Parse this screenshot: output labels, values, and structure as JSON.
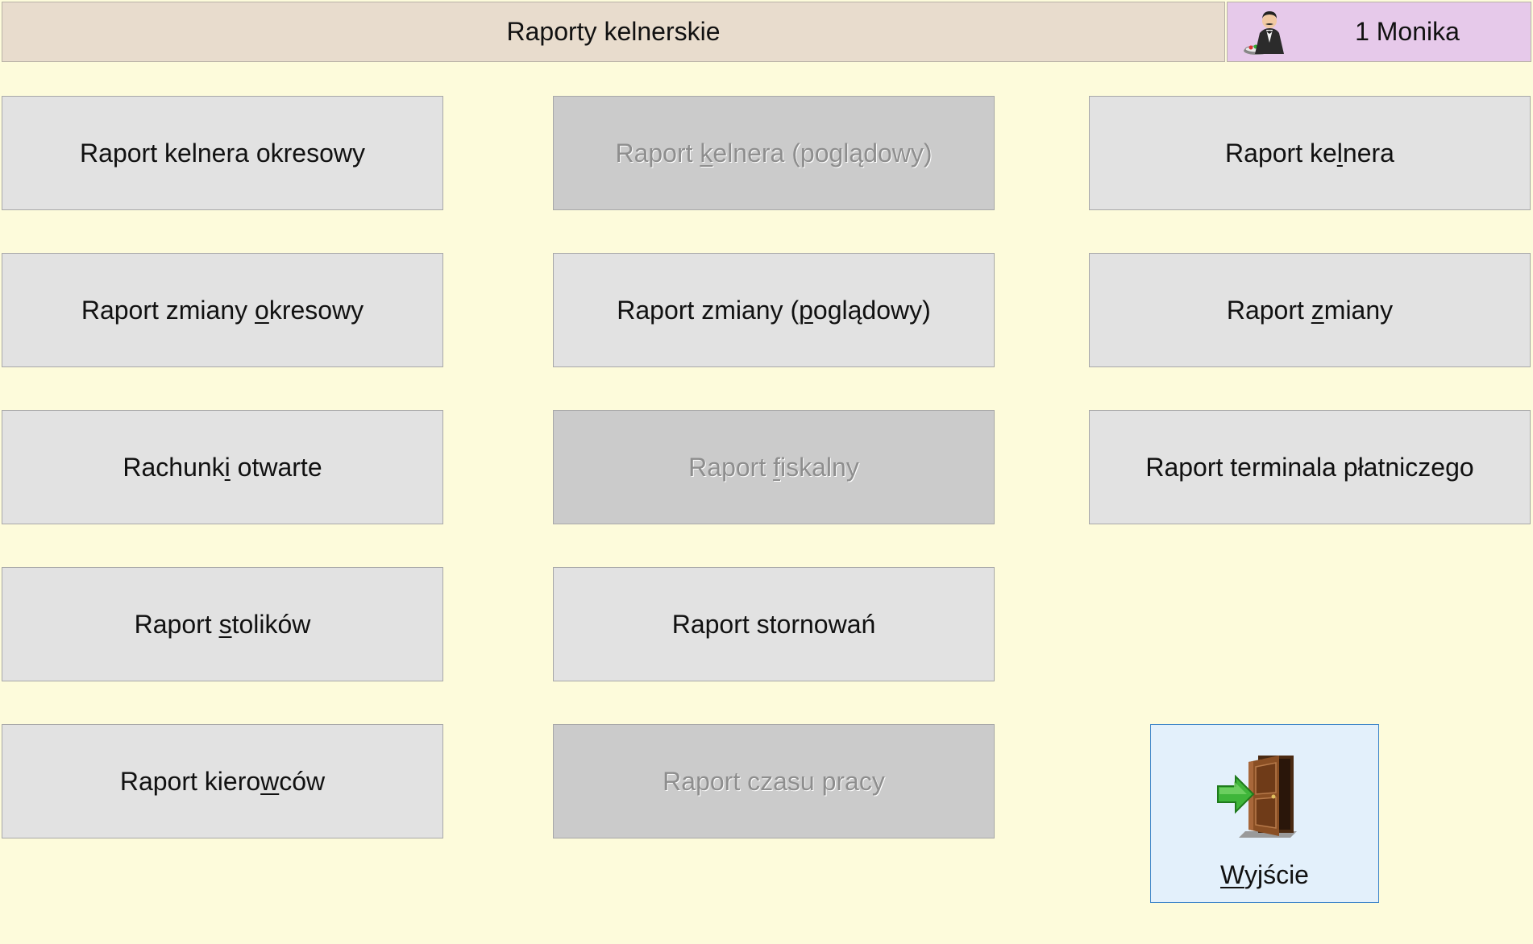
{
  "header": {
    "title": "Raporty kelnerskie",
    "user": "1 Monika"
  },
  "buttons": {
    "raport_kelnera_okresowy": {
      "pre": "Raport kelnera okresowy",
      "key": "",
      "post": "",
      "enabled": true
    },
    "raport_kelnera_pogladowy": {
      "pre": "Raport ",
      "key": "k",
      "post": "elnera (poglądowy)",
      "enabled": false
    },
    "raport_kelnera": {
      "pre": "Raport ke",
      "key": "l",
      "post": "nera",
      "enabled": true
    },
    "raport_zmiany_okresowy": {
      "pre": "Raport zmiany ",
      "key": "o",
      "post": "kresowy",
      "enabled": true
    },
    "raport_zmiany_pogladowy": {
      "pre": "Raport zmiany (",
      "key": "p",
      "post": "oglądowy)",
      "enabled": true
    },
    "raport_zmiany": {
      "pre": "Raport ",
      "key": "z",
      "post": "miany",
      "enabled": true
    },
    "rachunki_otwarte": {
      "pre": "Rachunk",
      "key": "i",
      "post": " otwarte",
      "enabled": true
    },
    "raport_fiskalny": {
      "pre": "Raport ",
      "key": "f",
      "post": "iskalny",
      "enabled": false
    },
    "raport_terminala": {
      "pre": "Raport terminala płatniczego",
      "key": "",
      "post": "",
      "enabled": true
    },
    "raport_stolikow": {
      "pre": "Raport ",
      "key": "s",
      "post": "tolików",
      "enabled": true
    },
    "raport_stornowan": {
      "pre": "Raport stornowań",
      "key": "",
      "post": "",
      "enabled": true
    },
    "raport_kierowcow": {
      "pre": "Raport kiero",
      "key": "w",
      "post": "ców",
      "enabled": true
    },
    "raport_czasu_pracy": {
      "pre": "Raport czasu pracy",
      "key": "",
      "post": "",
      "enabled": false
    }
  },
  "exit": {
    "key": "W",
    "rest": "yjście",
    "icon": "exit-door-icon"
  },
  "colors": {
    "background": "#fdfbdb",
    "title_bar": "#e8dccd",
    "user_bar": "#e6c9ea",
    "button": "#e2e2e2",
    "button_disabled": "#cbcbcb",
    "exit_button": "#e3f0fb",
    "exit_border": "#3f86c9"
  }
}
